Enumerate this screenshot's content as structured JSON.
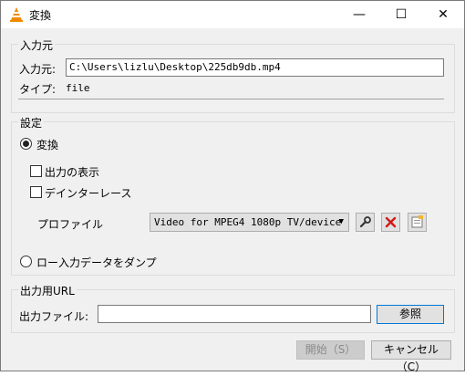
{
  "window": {
    "title": "変換",
    "min_glyph": "—",
    "max_glyph": "☐",
    "close_glyph": "✕"
  },
  "source": {
    "group_title": "入力元",
    "source_label": "入力元:",
    "source_value": "C:\\Users\\lizlu\\Desktop\\225db9db.mp4",
    "type_label": "タイプ:",
    "type_value": "file"
  },
  "settings": {
    "group_title": "設定",
    "convert_label": "変換",
    "convert_selected": true,
    "display_output_label": "出力の表示",
    "display_output_checked": false,
    "deinterlace_label": "デインターレース",
    "deinterlace_checked": false,
    "profile_label": "プロファイル",
    "profile_value": "Video for MPEG4 1080p TV/device",
    "edit_profile_icon": "wrench-icon",
    "delete_profile_icon": "red-x-icon",
    "new_profile_icon": "new-profile-icon",
    "dump_label": "ロー入力データをダンプ",
    "dump_selected": false
  },
  "destination": {
    "group_title": "出力用URL",
    "file_label": "出力ファイル:",
    "file_value": "",
    "browse_label": "参照"
  },
  "footer": {
    "start_label": "開始（S）",
    "start_disabled": true,
    "cancel_label": "キャンセル（C）"
  },
  "colors": {
    "accent": "#0078d7",
    "delete_red": "#d11919",
    "vlc_orange": "#f08a00"
  }
}
